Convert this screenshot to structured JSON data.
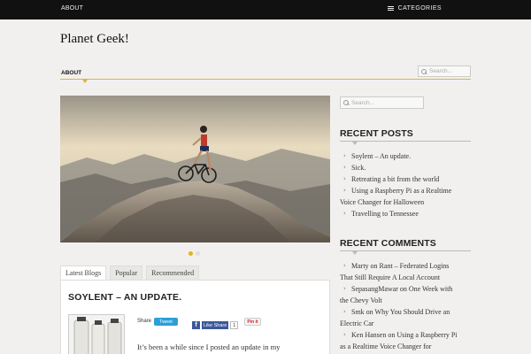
{
  "topbar": {
    "about": "ABOUT",
    "categories": "CATEGORIES"
  },
  "site": {
    "title": "Planet Geek!"
  },
  "nav": {
    "active": "ABOUT",
    "search_placeholder": "Search..."
  },
  "slider": {
    "current_dot": 1,
    "dot_count": 2
  },
  "tabs": [
    {
      "label": "Latest Blogs",
      "active": true
    },
    {
      "label": "Popular",
      "active": false
    },
    {
      "label": "Recommended",
      "active": false
    }
  ],
  "post": {
    "title": "SOYLENT – AN UPDATE.",
    "share_label": "Share",
    "tweet_label": "Tweet",
    "fb_like_share": "Like  Share",
    "fb_count": "1",
    "pin_label": "Pin it",
    "excerpt": "It’s been a while since I posted an update in my"
  },
  "sidebar": {
    "search_placeholder": "Search...",
    "recent_posts_title": "RECENT POSTS",
    "recent_posts": [
      [
        "Soylent – An update."
      ],
      [
        "Sick."
      ],
      [
        "Retreating a bit from the world"
      ],
      [
        "Using a Raspberry Pi as a Realtime",
        "Voice Changer for Halloween"
      ],
      [
        "Travelling to Tennessee"
      ]
    ],
    "recent_comments_title": "RECENT COMMENTS",
    "recent_comments": [
      [
        "Marty on Rant – Federated Logins",
        "That Still Require A Local Account"
      ],
      [
        "SepasangMawar on One Week with",
        "the Chevy Volt"
      ],
      [
        "Smk on Why You Should Drive an",
        "Electric Car"
      ],
      [
        "Ken Hansen on Using a Raspberry Pi",
        "as a Realtime Voice Changer for"
      ]
    ]
  },
  "colors": {
    "accent": "#d4b84a",
    "topbar": "#111111",
    "dot_active": "#e0b418"
  }
}
